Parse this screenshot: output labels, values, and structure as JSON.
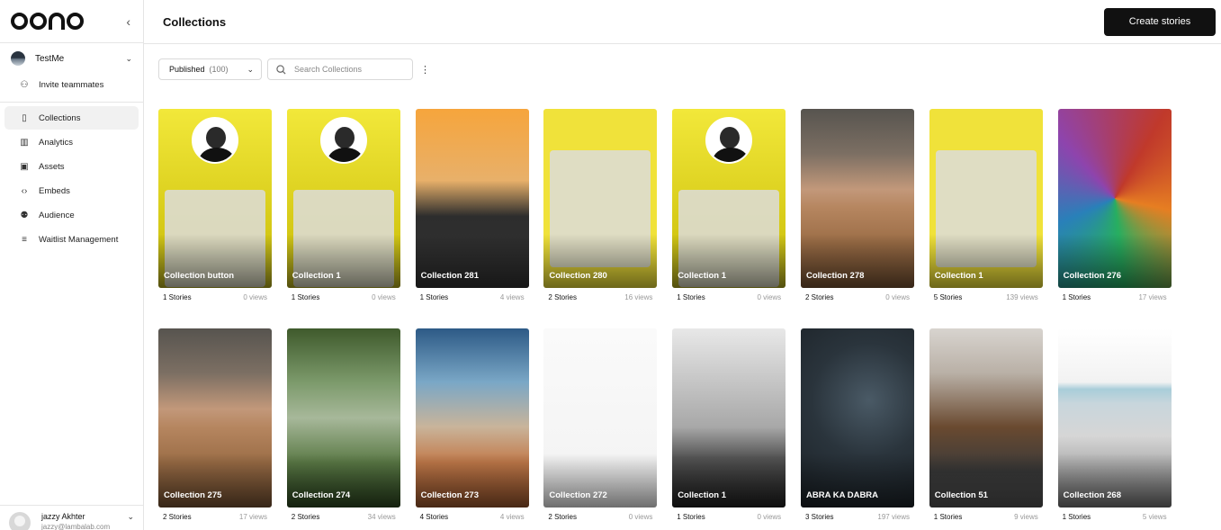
{
  "sidebar": {
    "workspace": "TestMe",
    "invite": "Invite teammates",
    "items": [
      {
        "label": "Collections",
        "icon": "book-icon"
      },
      {
        "label": "Analytics",
        "icon": "bar-chart-icon"
      },
      {
        "label": "Assets",
        "icon": "image-icon"
      },
      {
        "label": "Embeds",
        "icon": "code-icon"
      },
      {
        "label": "Audience",
        "icon": "users-icon"
      },
      {
        "label": "Waitlist Management",
        "icon": "list-icon"
      }
    ],
    "user": {
      "name": "jazzy Akhter",
      "email": "jazzy@lambalab.com"
    }
  },
  "header": {
    "title": "Collections",
    "create_label": "Create stories"
  },
  "filters": {
    "status": "Published",
    "count": "(100)",
    "search_placeholder": "Search Collections"
  },
  "collections": [
    {
      "title": "Collection button",
      "stories": "1 Stories",
      "views": "0 views",
      "style": "yellow portrait"
    },
    {
      "title": "Collection 1",
      "stories": "1 Stories",
      "views": "0 views",
      "style": "yellow portrait"
    },
    {
      "title": "Collection 281",
      "stories": "1 Stories",
      "views": "4 views",
      "style": "orange"
    },
    {
      "title": "Collection 280",
      "stories": "2 Stories",
      "views": "16 views",
      "style": "yellowbiz"
    },
    {
      "title": "Collection 1",
      "stories": "1 Stories",
      "views": "0 views",
      "style": "yellow portrait"
    },
    {
      "title": "Collection 278",
      "stories": "2 Stories",
      "views": "0 views",
      "style": "desert"
    },
    {
      "title": "Collection 1",
      "stories": "5 Stories",
      "views": "139 views",
      "style": "yellowbiz"
    },
    {
      "title": "Collection 276",
      "stories": "1 Stories",
      "views": "17 views",
      "style": "psy"
    },
    {
      "title": "Collection 275",
      "stories": "2 Stories",
      "views": "17 views",
      "style": "desert"
    },
    {
      "title": "Collection 274",
      "stories": "2 Stories",
      "views": "34 views",
      "style": "forest"
    },
    {
      "title": "Collection 273",
      "stories": "4 Stories",
      "views": "4 views",
      "style": "sky"
    },
    {
      "title": "Collection 272",
      "stories": "2 Stories",
      "views": "0 views",
      "style": "phone"
    },
    {
      "title": "Collection 1",
      "stories": "1 Stories",
      "views": "0 views",
      "style": "gray"
    },
    {
      "title": "ABRA KA DABRA",
      "stories": "3 Stories",
      "views": "197 views",
      "style": "night"
    },
    {
      "title": "Collection 51",
      "stories": "1 Stories",
      "views": "9 views",
      "style": "kitchen"
    },
    {
      "title": "Collection 268",
      "stories": "1 Stories",
      "views": "5 views",
      "style": "sea"
    }
  ]
}
